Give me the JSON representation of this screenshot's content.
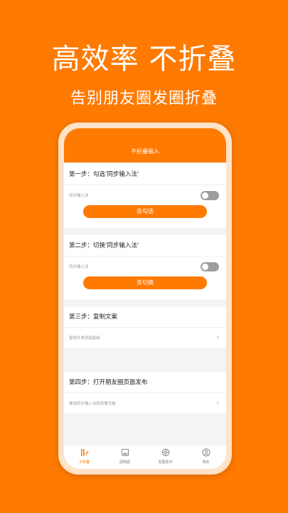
{
  "promo": {
    "title": "高效率 不折叠",
    "subtitle": "告别朋友圈发圈折叠"
  },
  "app": {
    "header_title": "不折叠输入"
  },
  "steps": [
    {
      "title": "第一步：勾选'同步输入法'",
      "row": "同步输入法",
      "button": "去勾选"
    },
    {
      "title": "第二步：切换'同步输入法'",
      "row": "同步输入法",
      "button": "去切换"
    },
    {
      "title": "第三步：复制文案",
      "row": "复制文本到粘贴板"
    },
    {
      "title": "第四步：打开朋友圈页面发布",
      "row": "使用同步输入法防折叠功能"
    }
  ],
  "tabs": [
    {
      "label": "不折叠",
      "icon": "edit-icon"
    },
    {
      "label": "图略圈",
      "icon": "image-icon"
    },
    {
      "label": "发圈素材",
      "icon": "aperture-icon"
    },
    {
      "label": "我的",
      "icon": "user-icon"
    }
  ],
  "colors": {
    "accent": "#FF7A00",
    "toggle_off": "#9E9E9E"
  }
}
